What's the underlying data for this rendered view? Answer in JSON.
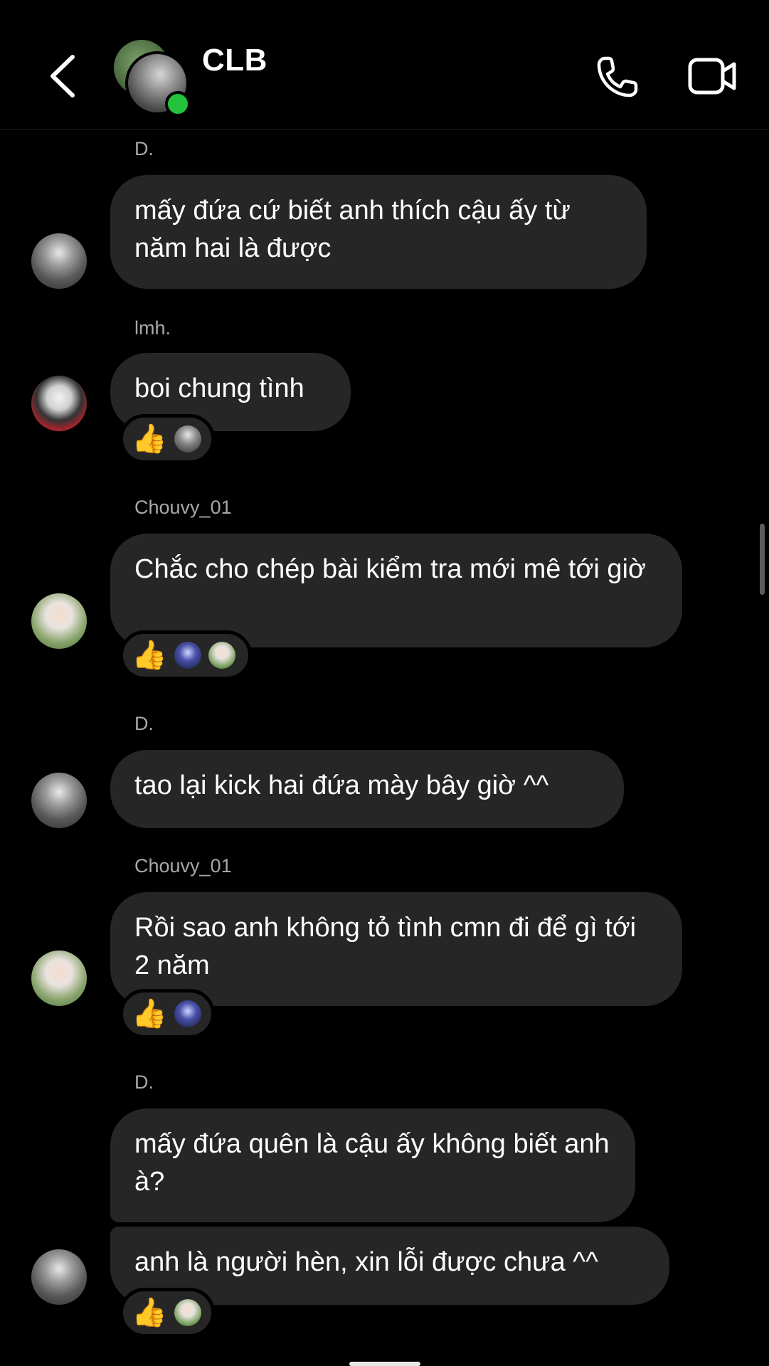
{
  "header": {
    "title": "CLB",
    "back_icon": "chevron-left-icon",
    "call_icon": "phone-icon",
    "video_icon": "video-camera-icon",
    "online_status_color": "#22c33a"
  },
  "messages": [
    {
      "sender": "D.",
      "text": "mấy đứa cứ biết anh thích cậu ấy từ năm hai là được"
    },
    {
      "sender": "lmh.",
      "text": "boi chung tình",
      "reactions": {
        "emoji": "👍"
      }
    },
    {
      "sender": "Chouvy_01",
      "text": "Chắc cho chép bài kiểm tra mới mê tới giờ",
      "reactions": {
        "emoji": "👍"
      }
    },
    {
      "sender": "D.",
      "text": "tao lại kick hai đứa mày bây giờ ^^"
    },
    {
      "sender": "Chouvy_01",
      "text": "Rồi sao anh không tỏ tình cmn đi để gì tới 2 năm",
      "reactions": {
        "emoji": "👍"
      }
    },
    {
      "sender": "D.",
      "text": "mấy đứa quên là cậu ấy không biết anh à?"
    },
    {
      "sender": "",
      "text": "anh là người hèn, xin lỗi được chưa ^^",
      "reactions": {
        "emoji": "👍"
      }
    }
  ],
  "theme": {
    "background": "#000000",
    "bubble": "#262626",
    "sender_name": "#a8a8a8"
  }
}
